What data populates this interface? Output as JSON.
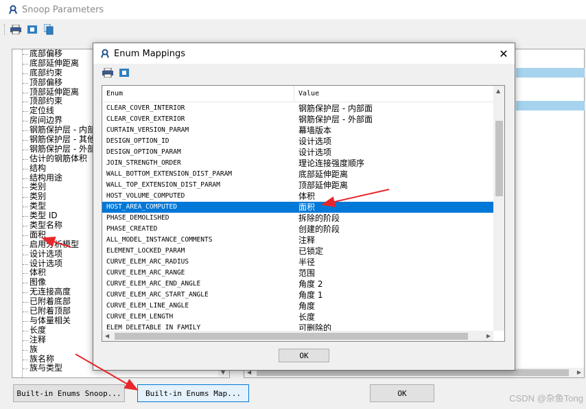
{
  "background_window": {
    "title": "Snoop Parameters",
    "tree_items": [
      "底部偏移",
      "底部延伸距离",
      "底部约束",
      "顶部偏移",
      "顶部延伸距离",
      "顶部约束",
      "定位线",
      "房间边界",
      "钢筋保护层 - 内部",
      "钢筋保护层 - 其他",
      "钢筋保护层 - 外部",
      "估计的钢筋体积",
      "结构",
      "结构用途",
      "类别",
      "类别",
      "类型",
      "类型 ID",
      "类型名称",
      "面积",
      "启用分析模型",
      "设计选项",
      "设计选项",
      "体积",
      "图像",
      "无连接高度",
      "已附着底部",
      "已附着顶部",
      "与体量相关",
      "长度",
      "注释",
      "族",
      "族名称",
      "族与类型"
    ],
    "buttons": {
      "builtin_snoop": "Built-in Enums Snoop...",
      "builtin_map": "Built-in Enums Map...",
      "ok": "OK"
    },
    "watermark": "CSDN @杂鱼Tong"
  },
  "dialog": {
    "title": "Enum Mappings",
    "columns": {
      "enum": "Enum",
      "value": "Value"
    },
    "rows": [
      {
        "enum": "CLEAR_COVER_INTERIOR",
        "value": "钢筋保护层 - 内部面"
      },
      {
        "enum": "CLEAR_COVER_EXTERIOR",
        "value": "钢筋保护层 - 外部面"
      },
      {
        "enum": "CURTAIN_VERSION_PARAM",
        "value": "幕墙版本"
      },
      {
        "enum": "DESIGN_OPTION_ID",
        "value": "设计选项"
      },
      {
        "enum": "DESIGN_OPTION_PARAM",
        "value": "设计选项"
      },
      {
        "enum": "JOIN_STRENGTH_ORDER",
        "value": "理论连接强度顺序"
      },
      {
        "enum": "WALL_BOTTOM_EXTENSION_DIST_PARAM",
        "value": "底部延伸距离"
      },
      {
        "enum": "WALL_TOP_EXTENSION_DIST_PARAM",
        "value": "顶部延伸距离"
      },
      {
        "enum": "HOST_VOLUME_COMPUTED",
        "value": "体积"
      },
      {
        "enum": "HOST_AREA_COMPUTED",
        "value": "面积",
        "selected": true
      },
      {
        "enum": "PHASE_DEMOLISHED",
        "value": "拆除的阶段"
      },
      {
        "enum": "PHASE_CREATED",
        "value": "创建的阶段"
      },
      {
        "enum": "ALL_MODEL_INSTANCE_COMMENTS",
        "value": "注释"
      },
      {
        "enum": "ELEMENT_LOCKED_PARAM",
        "value": "已锁定"
      },
      {
        "enum": "CURVE_ELEM_ARC_RADIUS",
        "value": "半径"
      },
      {
        "enum": "CURVE_ELEM_ARC_RANGE",
        "value": "范围"
      },
      {
        "enum": "CURVE_ELEM_ARC_END_ANGLE",
        "value": "角度 2"
      },
      {
        "enum": "CURVE_ELEM_ARC_START_ANGLE",
        "value": "角度 1"
      },
      {
        "enum": "CURVE_ELEM_LINE_ANGLE",
        "value": "角度"
      },
      {
        "enum": "CURVE_ELEM_LENGTH",
        "value": "长度"
      },
      {
        "enum": "ELEM_DELETABLE_IN_FAMILY",
        "value": "可删除的"
      }
    ],
    "ok_label": "OK"
  },
  "icons": [
    "revit-logo-icon",
    "print-icon",
    "snoop-icon",
    "copy-icon",
    "close-icon"
  ],
  "colors": {
    "selection": "#0078d7",
    "stripe": "#a6d3ee",
    "annotation_arrow": "#e8262a"
  }
}
